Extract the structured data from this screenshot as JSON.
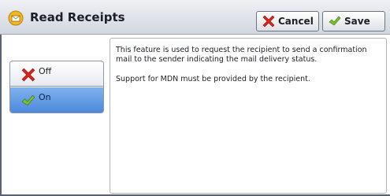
{
  "header": {
    "title": "Read Receipts",
    "title_icon": "envelope-icon",
    "cancel_label": "Cancel",
    "cancel_icon": "red-x-icon",
    "save_label": "Save",
    "save_icon": "checkmark-icon"
  },
  "options": {
    "selected": "On",
    "items": [
      {
        "label": "Off",
        "icon": "red-x-icon"
      },
      {
        "label": "On",
        "icon": "checkmark-icon"
      }
    ]
  },
  "description": {
    "paragraph1": "This feature is used to request the recipient to send a confirmation mail to the sender indicating the mail delivery status.",
    "paragraph2": "Support for MDN must be provided by the recipient."
  },
  "colors": {
    "selected_option": "#5b93e0",
    "cancel_icon": "#d9271e",
    "save_icon": "#7ac12e",
    "title_icon": "#f0b020"
  }
}
